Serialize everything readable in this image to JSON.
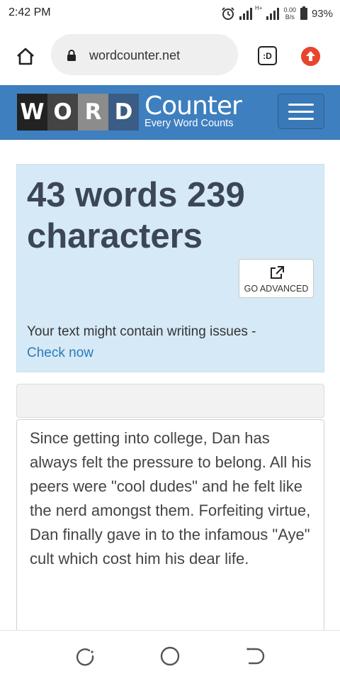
{
  "status_bar": {
    "time": "2:42 PM",
    "network_type": "H+",
    "net_speed_value": "0.00",
    "net_speed_unit": "B/s",
    "battery": "93%"
  },
  "browser": {
    "url": "wordcounter.net",
    "tab_switcher_label": ":D",
    "icons": [
      "home-icon",
      "lock-icon",
      "tab-switcher-icon",
      "upload-icon"
    ]
  },
  "site_header": {
    "logo_letters": [
      "W",
      "O",
      "R",
      "D"
    ],
    "logo_title": "Counter",
    "logo_tagline": "Every Word Counts",
    "colors": {
      "header": "#3e7fbf",
      "logo_w": "#222222",
      "logo_o": "#444444",
      "logo_r": "#8c8c8c",
      "logo_d": "#3a5c85"
    }
  },
  "stats": {
    "headline": "43 words 239 characters",
    "advanced_button_label": "GO ADVANCED",
    "issues_text": "Your text might contain writing issues -",
    "issues_link": "Check now"
  },
  "editor": {
    "text": "Since getting into college, Dan has always felt the pressure to belong. All his peers were \"cool dudes\" and he felt like the nerd amongst them. Forfeiting virtue, Dan finally gave in to the infamous \"Aye\" cult which cost him his dear life."
  },
  "nav_bar": {
    "icons": [
      "recent-apps-icon",
      "home-circle-icon",
      "back-icon"
    ]
  }
}
